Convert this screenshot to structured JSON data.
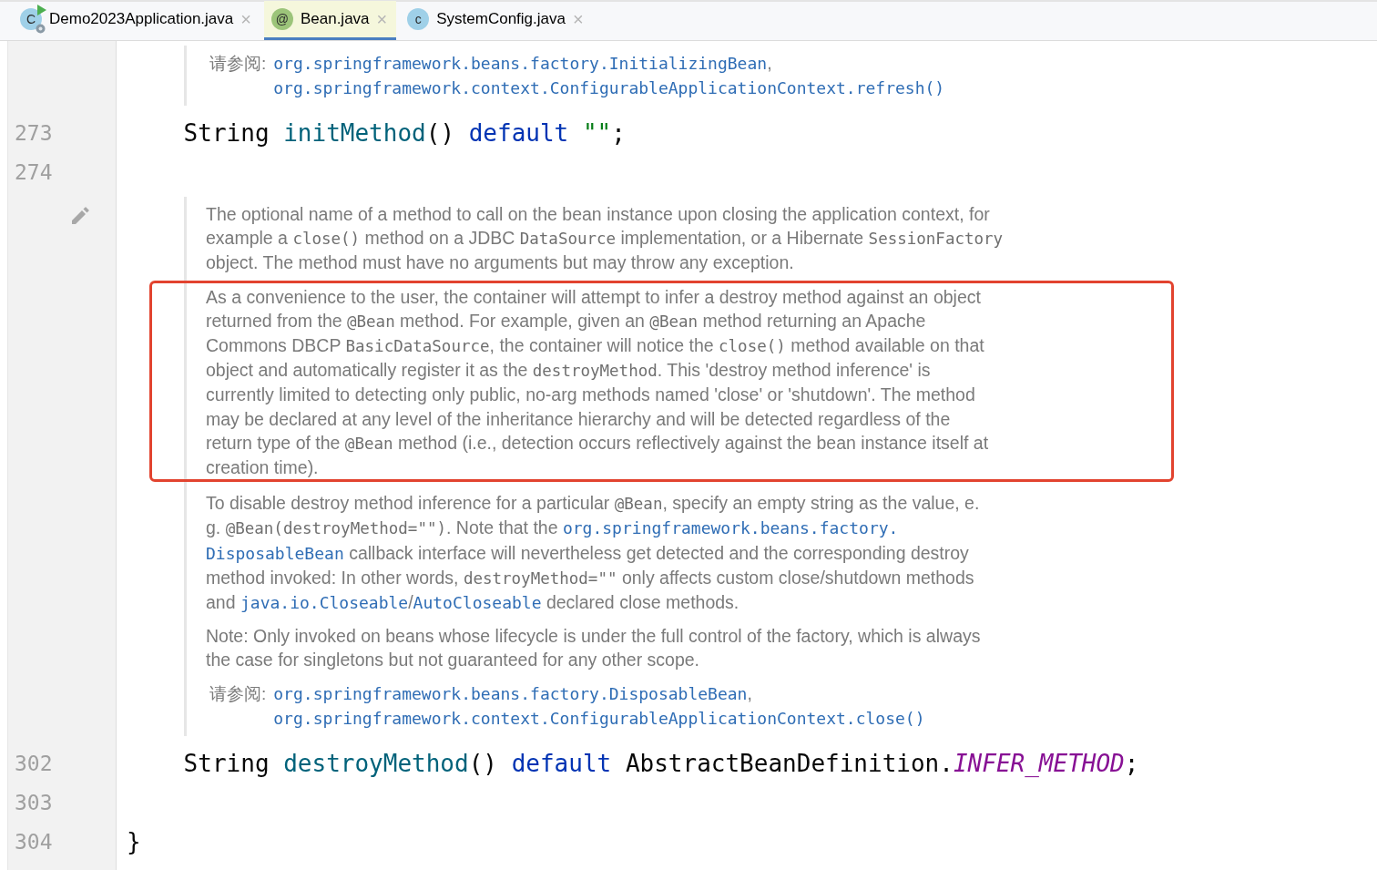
{
  "tabs": [
    {
      "label": "Demo2023Application.java",
      "kind": "app",
      "icon_text": "C",
      "close": "×",
      "selected": false
    },
    {
      "label": "Bean.java",
      "kind": "annotation",
      "icon_text": "@",
      "close": "×",
      "selected": true
    },
    {
      "label": "SystemConfig.java",
      "kind": "class",
      "icon_text": "c",
      "close": "×",
      "selected": false
    }
  ],
  "editor_lines": [
    {
      "kind": "doc",
      "items": [
        {
          "kind": "see_also",
          "label": "请参阅:",
          "links": [
            {
              "text": "org.springframework.beans.factory.InitializingBean",
              "sep": ","
            },
            {
              "text": "org.springframework.context.ConfigurableApplicationContext.refresh()"
            }
          ]
        }
      ]
    },
    {
      "kind": "code",
      "number": "273",
      "tokens": [
        {
          "t": "    String ",
          "kind": "plain"
        },
        {
          "t": "initMethod",
          "kind": "method"
        },
        {
          "t": "() ",
          "kind": "plain"
        },
        {
          "t": "default ",
          "kind": "keyword"
        },
        {
          "t": "\"\"",
          "kind": "string"
        },
        {
          "t": ";",
          "kind": "plain"
        }
      ]
    },
    {
      "kind": "code",
      "number": "274"
    },
    {
      "kind": "doc",
      "rendered": true,
      "items": [
        {
          "kind": "paragraph",
          "highlighted": false,
          "lines": [
            [
              {
                "t": "The optional name of a method to call on the bean instance upon closing the application context, for",
                "kind": "text"
              }
            ],
            [
              {
                "t": "example a ",
                "kind": "text"
              },
              {
                "t": "close()",
                "kind": "code"
              },
              {
                "t": " method on a JDBC ",
                "kind": "text"
              },
              {
                "t": "DataSource",
                "kind": "code"
              },
              {
                "t": " implementation, or a Hibernate ",
                "kind": "text"
              },
              {
                "t": "SessionFactory",
                "kind": "code"
              }
            ],
            [
              {
                "t": "object. The method must have no arguments but may throw any exception.",
                "kind": "text"
              }
            ]
          ]
        },
        {
          "kind": "paragraph",
          "highlighted": true,
          "lines": [
            [
              {
                "t": "As a convenience to the user, the container will attempt to infer a destroy method against an object",
                "kind": "text"
              }
            ],
            [
              {
                "t": "returned from the ",
                "kind": "text"
              },
              {
                "t": "@Bean",
                "kind": "code"
              },
              {
                "t": " method. For example, given an ",
                "kind": "text"
              },
              {
                "t": "@Bean",
                "kind": "code"
              },
              {
                "t": " method returning an Apache",
                "kind": "text"
              }
            ],
            [
              {
                "t": "Commons DBCP ",
                "kind": "text"
              },
              {
                "t": "BasicDataSource",
                "kind": "code"
              },
              {
                "t": ", the container will notice the ",
                "kind": "text"
              },
              {
                "t": "close()",
                "kind": "code"
              },
              {
                "t": " method available on that",
                "kind": "text"
              }
            ],
            [
              {
                "t": "object and automatically register it as the ",
                "kind": "text"
              },
              {
                "t": "destroyMethod",
                "kind": "code"
              },
              {
                "t": ". This 'destroy method inference' is",
                "kind": "text"
              }
            ],
            [
              {
                "t": "currently limited to detecting only public, no-arg methods named 'close' or 'shutdown'. The method",
                "kind": "text"
              }
            ],
            [
              {
                "t": "may be declared at any level of the inheritance hierarchy and will be detected regardless of the",
                "kind": "text"
              }
            ],
            [
              {
                "t": "return type of the ",
                "kind": "text"
              },
              {
                "t": "@Bean",
                "kind": "code"
              },
              {
                "t": " method (i.e., detection occurs reflectively against the bean instance itself at",
                "kind": "text"
              }
            ],
            [
              {
                "t": "creation time).",
                "kind": "text"
              }
            ]
          ]
        },
        {
          "kind": "paragraph",
          "highlighted": false,
          "lines": [
            [
              {
                "t": "To disable destroy method inference for a particular ",
                "kind": "text"
              },
              {
                "t": "@Bean",
                "kind": "code"
              },
              {
                "t": ", specify an empty string as the value, e.",
                "kind": "text"
              }
            ],
            [
              {
                "t": "g. ",
                "kind": "text"
              },
              {
                "t": "@Bean(destroyMethod=\"\")",
                "kind": "code"
              },
              {
                "t": ". Note that the ",
                "kind": "text"
              },
              {
                "t": "org.springframework.beans.factory.",
                "kind": "link"
              }
            ],
            [
              {
                "t": "DisposableBean",
                "kind": "link"
              },
              {
                "t": " callback interface will nevertheless get detected and the corresponding destroy",
                "kind": "text"
              }
            ],
            [
              {
                "t": "method invoked: In other words, ",
                "kind": "text"
              },
              {
                "t": "destroyMethod=\"\"",
                "kind": "code"
              },
              {
                "t": " only affects custom close/shutdown methods",
                "kind": "text"
              }
            ],
            [
              {
                "t": "and ",
                "kind": "text"
              },
              {
                "t": "java.io.Closeable",
                "kind": "link"
              },
              {
                "t": "/",
                "kind": "text"
              },
              {
                "t": "AutoCloseable",
                "kind": "link"
              },
              {
                "t": " declared close methods.",
                "kind": "text"
              }
            ]
          ]
        },
        {
          "kind": "paragraph",
          "highlighted": false,
          "lines": [
            [
              {
                "t": "Note: Only invoked on beans whose lifecycle is under the full control of the factory, which is always",
                "kind": "text"
              }
            ],
            [
              {
                "t": "the case for singletons but not guaranteed for any other scope.",
                "kind": "text"
              }
            ]
          ]
        },
        {
          "kind": "see_also",
          "label": "请参阅:",
          "links": [
            {
              "text": "org.springframework.beans.factory.DisposableBean",
              "sep": ","
            },
            {
              "text": "org.springframework.context.ConfigurableApplicationContext.close()"
            }
          ]
        }
      ]
    },
    {
      "kind": "code",
      "number": "302",
      "tokens": [
        {
          "t": "    String ",
          "kind": "plain"
        },
        {
          "t": "destroyMethod",
          "kind": "method"
        },
        {
          "t": "() ",
          "kind": "plain"
        },
        {
          "t": "default",
          "kind": "keyword"
        },
        {
          "t": " AbstractBeanDefinition.",
          "kind": "plain"
        },
        {
          "t": "INFER_METHOD",
          "kind": "static_field"
        },
        {
          "t": ";",
          "kind": "plain"
        }
      ]
    },
    {
      "kind": "code",
      "number": "303"
    },
    {
      "kind": "code",
      "number": "304",
      "tokens": [
        {
          "t": "}",
          "kind": "plain"
        }
      ]
    }
  ]
}
